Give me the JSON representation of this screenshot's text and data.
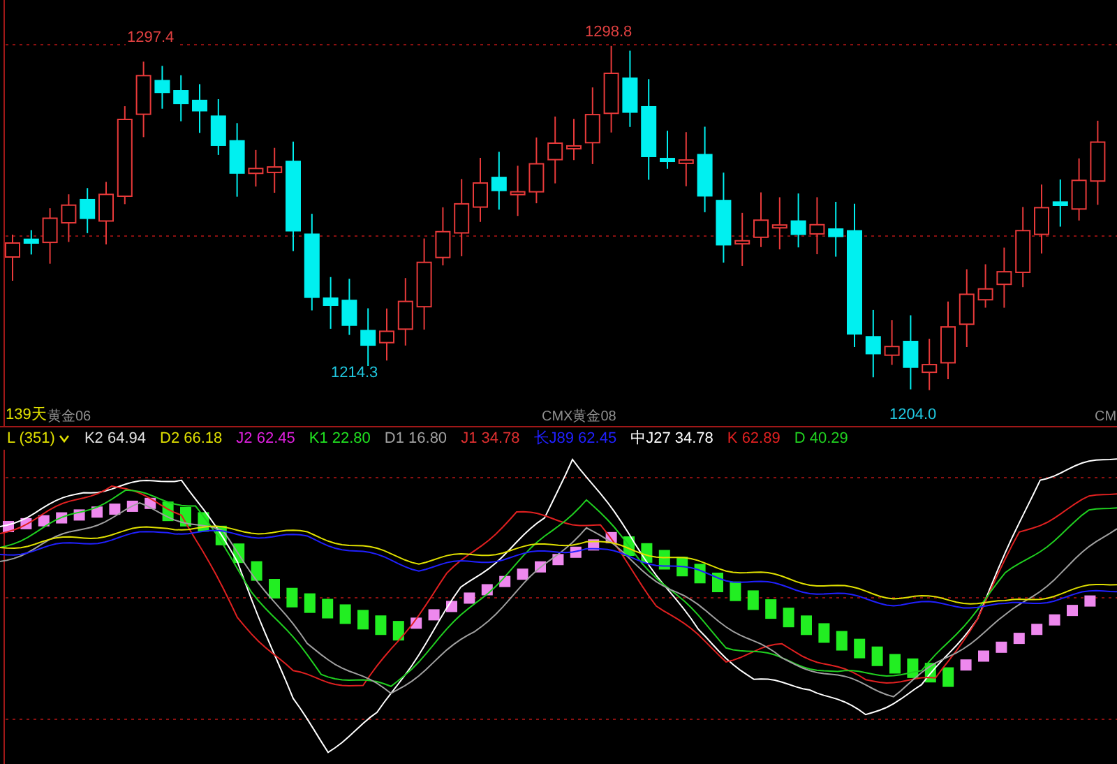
{
  "price_chart": {
    "price_labels": [
      {
        "text": "1297.4",
        "color": "#e04040"
      },
      {
        "text": "1298.8",
        "color": "#e04040"
      },
      {
        "text": "1214.3",
        "color": "#20c8e0"
      },
      {
        "text": "1204.0",
        "color": "#20c8e0"
      }
    ],
    "period_label": "139天",
    "contract_labels": [
      "黄金06",
      "CMX黄金08",
      "CM"
    ]
  },
  "indicator": {
    "legend": [
      {
        "kind": "dropdown",
        "text": "L (351)",
        "color": "#e0e000"
      },
      {
        "kind": "value",
        "text": "K2 64.94",
        "color": "#e0e0e0"
      },
      {
        "kind": "value",
        "text": "D2 66.18",
        "color": "#e0e000"
      },
      {
        "kind": "value",
        "text": "J2 62.45",
        "color": "#e020e0"
      },
      {
        "kind": "value",
        "text": "K1 22.80",
        "color": "#20e020"
      },
      {
        "kind": "value",
        "text": "D1 16.80",
        "color": "#a0a0a0"
      },
      {
        "kind": "value",
        "text": "J1 34.78",
        "color": "#e03030"
      },
      {
        "kind": "value",
        "text": "长J89 62.45",
        "color": "#2020ff"
      },
      {
        "kind": "value",
        "text": "中J27 34.78",
        "color": "#ffffff"
      },
      {
        "kind": "value",
        "text": "K 62.89",
        "color": "#e02020"
      },
      {
        "kind": "value",
        "text": "D 40.29",
        "color": "#20d020"
      }
    ]
  }
}
